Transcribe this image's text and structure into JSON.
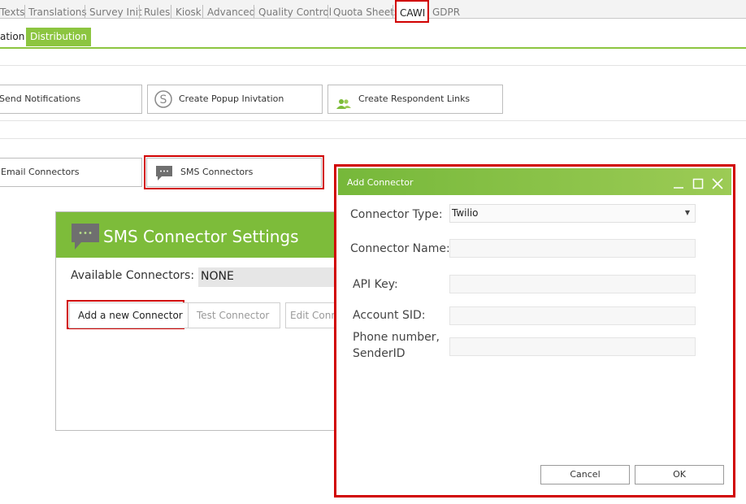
{
  "top_tabs": [
    "Texts",
    "Translations",
    "Survey Init",
    "Rules",
    "Kiosk",
    "Advanced",
    "Quality Control",
    "Quota Sheets",
    "CAWI",
    "GDPR"
  ],
  "sub_tabs": {
    "partial": "ation",
    "active": "Distribution"
  },
  "actions": {
    "send_notifications": "Send Notifications",
    "create_popup": "Create Popup Inivtation",
    "create_links": "Create Respondent Links"
  },
  "connectors": {
    "email": "Email Connectors",
    "sms": "SMS Connectors"
  },
  "sms_panel": {
    "title": "SMS Connector Settings",
    "available_label": "Available Connectors:",
    "available_value": "NONE",
    "add_button": "Add a new Connector",
    "test_button": "Test Connector",
    "edit_button": "Edit Conn"
  },
  "dialog": {
    "title": "Add Connector",
    "connector_type_label": "Connector Type:",
    "connector_type_value": "Twilio",
    "connector_name_label": "Connector Name:",
    "api_key_label": "API Key:",
    "account_sid_label": "Account SID:",
    "phone_label_line1": "Phone number,",
    "phone_label_line2": "SenderID",
    "cancel": "Cancel",
    "ok": "OK"
  },
  "colors": {
    "accent": "#8cc540",
    "highlight": "#d10000"
  }
}
